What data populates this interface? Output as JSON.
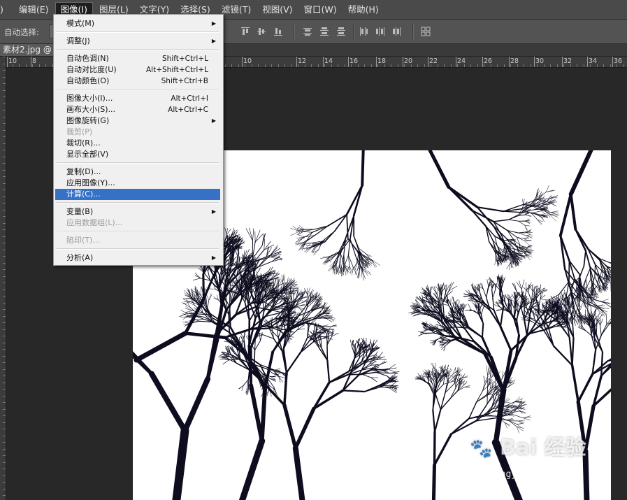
{
  "menubar": {
    "items": [
      {
        "label": ")"
      },
      {
        "label": "编辑(E)"
      },
      {
        "label": "图像(I)"
      },
      {
        "label": "图层(L)"
      },
      {
        "label": "文字(Y)"
      },
      {
        "label": "选择(S)"
      },
      {
        "label": "滤镜(T)"
      },
      {
        "label": "视图(V)"
      },
      {
        "label": "窗口(W)"
      },
      {
        "label": "帮助(H)"
      }
    ]
  },
  "options_bar": {
    "auto_select_label": "自动选择:"
  },
  "document": {
    "tab_label": "素材2.jpg @ 6"
  },
  "ruler": {
    "labels": [
      "10",
      "8",
      "8",
      "10",
      "12",
      "14",
      "16",
      "18",
      "20",
      "22",
      "24",
      "26",
      "28",
      "30",
      "32",
      "34",
      "36"
    ]
  },
  "image_menu": {
    "items": [
      {
        "label": "模式(M)",
        "submenu": true
      },
      {
        "label": "调整(J)",
        "submenu": true
      },
      {
        "label": "自动色调(N)",
        "shortcut": "Shift+Ctrl+L"
      },
      {
        "label": "自动对比度(U)",
        "shortcut": "Alt+Shift+Ctrl+L"
      },
      {
        "label": "自动颜色(O)",
        "shortcut": "Shift+Ctrl+B"
      },
      {
        "label": "图像大小(I)...",
        "shortcut": "Alt+Ctrl+I"
      },
      {
        "label": "画布大小(S)...",
        "shortcut": "Alt+Ctrl+C"
      },
      {
        "label": "图像旋转(G)",
        "submenu": true
      },
      {
        "label": "裁剪(P)",
        "disabled": true
      },
      {
        "label": "裁切(R)..."
      },
      {
        "label": "显示全部(V)"
      },
      {
        "label": "复制(D)..."
      },
      {
        "label": "应用图像(Y)..."
      },
      {
        "label": "计算(C)...",
        "highlighted": true
      },
      {
        "label": "变量(B)",
        "submenu": true
      },
      {
        "label": "应用数据组(L)...",
        "disabled": true
      },
      {
        "label": "陷印(T)...",
        "disabled": true
      },
      {
        "label": "分析(A)",
        "submenu": true
      }
    ]
  },
  "watermark": {
    "text": "Bai 经验",
    "sub": "jingyan.baidu.com"
  },
  "colors": {
    "highlight": "#3571c5",
    "menubar": "#4a4a4a",
    "workspace": "#282828"
  }
}
